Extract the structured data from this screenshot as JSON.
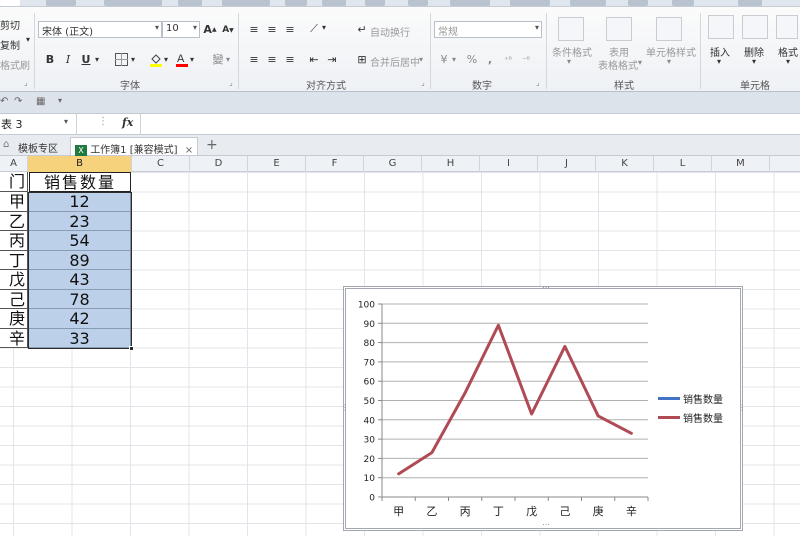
{
  "ribbon": {
    "clipboard": {
      "cut": "剪切",
      "copy": "复制",
      "format_painter": "格式刷"
    },
    "font": {
      "family": "宋体 (正文)",
      "size": "10",
      "grow": "A",
      "shrink": "A",
      "bold": "B",
      "italic": "I",
      "underline": "U",
      "fill_color": "#ffff00",
      "font_color": "#ff0000",
      "wen": "變",
      "group_label": "字体"
    },
    "alignment": {
      "wrap": "自动换行",
      "merge": "合并后居中",
      "group_label": "对齐方式"
    },
    "number": {
      "format": "常规",
      "percent": "%",
      "comma": ",",
      "group_label": "数字"
    },
    "styles": {
      "conditional": "条件格式",
      "table": "表用",
      "table2": "表格格式",
      "cell_style": "单元格样式",
      "group_label": "样式"
    },
    "cells": {
      "insert": "插入",
      "delete": "删除",
      "format": "格式",
      "group_label": "单元格"
    }
  },
  "formula_bar": {
    "name_box": "表 3",
    "fx": "fx"
  },
  "workbook_tabs": [
    {
      "label": "模板专区"
    },
    {
      "label": "工作簿1 [兼容模式]"
    }
  ],
  "tab_close": "×",
  "tab_add": "+",
  "columns": [
    "A",
    "B",
    "C",
    "D",
    "E",
    "F",
    "G",
    "H",
    "I",
    "J",
    "K",
    "L",
    "M"
  ],
  "sheet": {
    "header": {
      "a": "门",
      "b": "销售数量"
    },
    "rows": [
      {
        "a": "甲",
        "b": "12"
      },
      {
        "a": "乙",
        "b": "23"
      },
      {
        "a": "丙",
        "b": "54"
      },
      {
        "a": "丁",
        "b": "89"
      },
      {
        "a": "戊",
        "b": "43"
      },
      {
        "a": "己",
        "b": "78"
      },
      {
        "a": "庚",
        "b": "42"
      },
      {
        "a": "辛",
        "b": "33"
      }
    ]
  },
  "chart_data": {
    "type": "line",
    "categories": [
      "甲",
      "乙",
      "丙",
      "丁",
      "戊",
      "己",
      "庚",
      "辛"
    ],
    "series": [
      {
        "name": "销售数量",
        "values": [],
        "color": "#4472c4"
      },
      {
        "name": "销售数量",
        "values": [
          12,
          23,
          54,
          89,
          43,
          78,
          42,
          33
        ],
        "color": "#b04a55"
      }
    ],
    "ylim": [
      0,
      100
    ],
    "yticks": [
      0,
      10,
      20,
      30,
      40,
      50,
      60,
      70,
      80,
      90,
      100
    ],
    "grid": true,
    "legend": "right",
    "title": "",
    "xlabel": "",
    "ylabel": ""
  }
}
